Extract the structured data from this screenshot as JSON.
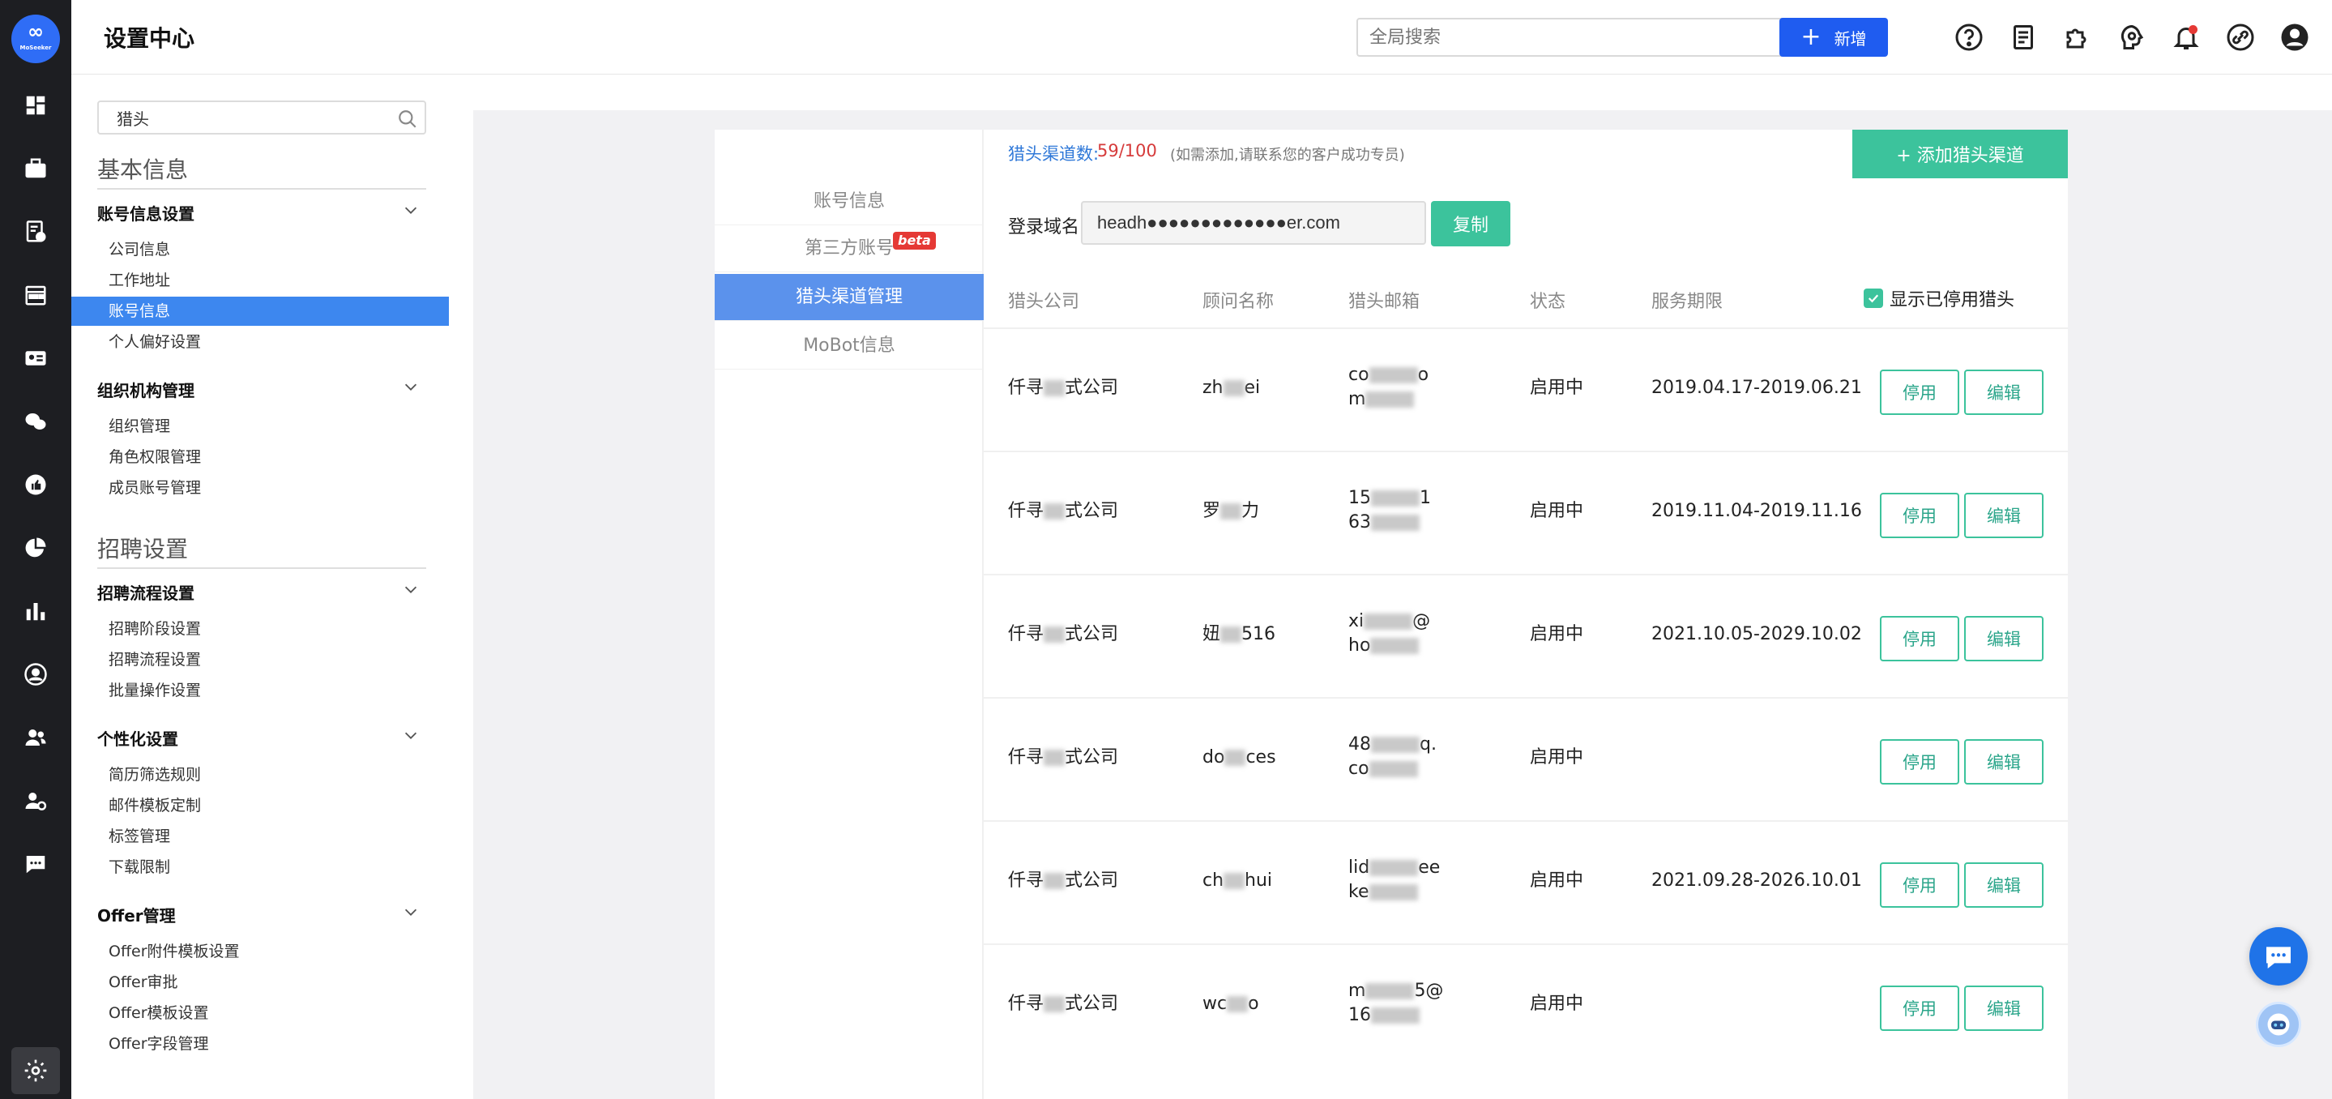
{
  "app": {
    "title": "设置中心",
    "logo_text": "∞",
    "logo_subtext": "MoSeeker"
  },
  "topbar": {
    "search_placeholder": "全局搜索",
    "new_label": "新增",
    "icons": [
      "help-icon",
      "document-icon",
      "plugin-icon",
      "support-icon",
      "notification-icon",
      "link-icon",
      "user-icon"
    ]
  },
  "rail": {
    "icons": [
      "dashboard-icon",
      "briefcase-icon",
      "resume-icon",
      "calendar-icon",
      "id-card-icon",
      "wechat-icon",
      "thumbs-up-icon",
      "pie-chart-icon",
      "bar-chart-icon",
      "headhunter-icon",
      "team-icon",
      "user-settings-icon",
      "message-icon",
      "settings-icon"
    ]
  },
  "sidebar": {
    "search_value": "猎头",
    "section1": "基本信息",
    "group1": {
      "title": "账号信息设置",
      "items": [
        "公司信息",
        "工作地址",
        "账号信息",
        "个人偏好设置"
      ]
    },
    "group2": {
      "title": "组织机构管理",
      "items": [
        "组织管理",
        "角色权限管理",
        "成员账号管理"
      ]
    },
    "section2": "招聘设置",
    "group3": {
      "title": "招聘流程设置",
      "items": [
        "招聘阶段设置",
        "招聘流程设置",
        "批量操作设置"
      ]
    },
    "group4": {
      "title": "个性化设置",
      "items": [
        "简历筛选规则",
        "邮件模板定制",
        "标签管理",
        "下载限制"
      ]
    },
    "group5": {
      "title": "Offer管理",
      "items": [
        "Offer附件模板设置",
        "Offer审批",
        "Offer模板设置",
        "Offer字段管理"
      ]
    }
  },
  "subnav": {
    "items": [
      "账号信息",
      "第三方账号",
      "猎头渠道管理",
      "MoBot信息"
    ],
    "beta": "beta"
  },
  "main": {
    "quota_label": "猎头渠道数:",
    "quota_value": "59/100",
    "quota_note": "(如需添加,请联系您的客户成功专员)",
    "add_button": "+ 添加猎头渠道",
    "domain_label": "登录域名",
    "domain_value": "headh●●●●●●●●●●●●●er.com",
    "copy_button": "复制",
    "columns": [
      "猎头公司",
      "顾问名称",
      "猎头邮箱",
      "状态",
      "服务期限"
    ],
    "show_disabled": "显示已停用猎头",
    "disable_label": "停用",
    "edit_label": "编辑",
    "rows": [
      {
        "company_a": "仟寻",
        "company_b": "式公司",
        "name_a": "zh",
        "name_b": "ei",
        "email_1a": "co",
        "email_1b": "o",
        "email_2a": "m",
        "email_2b": "",
        "status": "启用中",
        "period": "2019.04.17-2019.06.21"
      },
      {
        "company_a": "仟寻",
        "company_b": "式公司",
        "name_a": "罗",
        "name_b": "力",
        "email_1a": "15",
        "email_1b": "1",
        "email_2a": "63",
        "email_2b": "",
        "status": "启用中",
        "period": "2019.11.04-2019.11.16"
      },
      {
        "company_a": "仟寻",
        "company_b": "式公司",
        "name_a": "妞",
        "name_b": "516",
        "email_1a": "xi",
        "email_1b": "@",
        "email_2a": "ho",
        "email_2b": "",
        "status": "启用中",
        "period": "2021.10.05-2029.10.02"
      },
      {
        "company_a": "仟寻",
        "company_b": "式公司",
        "name_a": "do",
        "name_b": "ces",
        "email_1a": "48",
        "email_1b": "q.",
        "email_2a": "co",
        "email_2b": "",
        "status": "启用中",
        "period": ""
      },
      {
        "company_a": "仟寻",
        "company_b": "式公司",
        "name_a": "ch",
        "name_b": "hui",
        "email_1a": "lid",
        "email_1b": "ee",
        "email_2a": "ke",
        "email_2b": "",
        "status": "启用中",
        "period": "2021.09.28-2026.10.01"
      },
      {
        "company_a": "仟寻",
        "company_b": "式公司",
        "name_a": "wc",
        "name_b": "o",
        "email_1a": "m",
        "email_1b": "5@",
        "email_2a": "16",
        "email_2b": "",
        "status": "启用中",
        "period": ""
      }
    ]
  },
  "colors": {
    "accent": "#3cc39c",
    "primary": "#1f5cf0",
    "active_nav": "#3d87ef",
    "subnav_active": "#5b92ec",
    "danger": "#d63b3b"
  }
}
